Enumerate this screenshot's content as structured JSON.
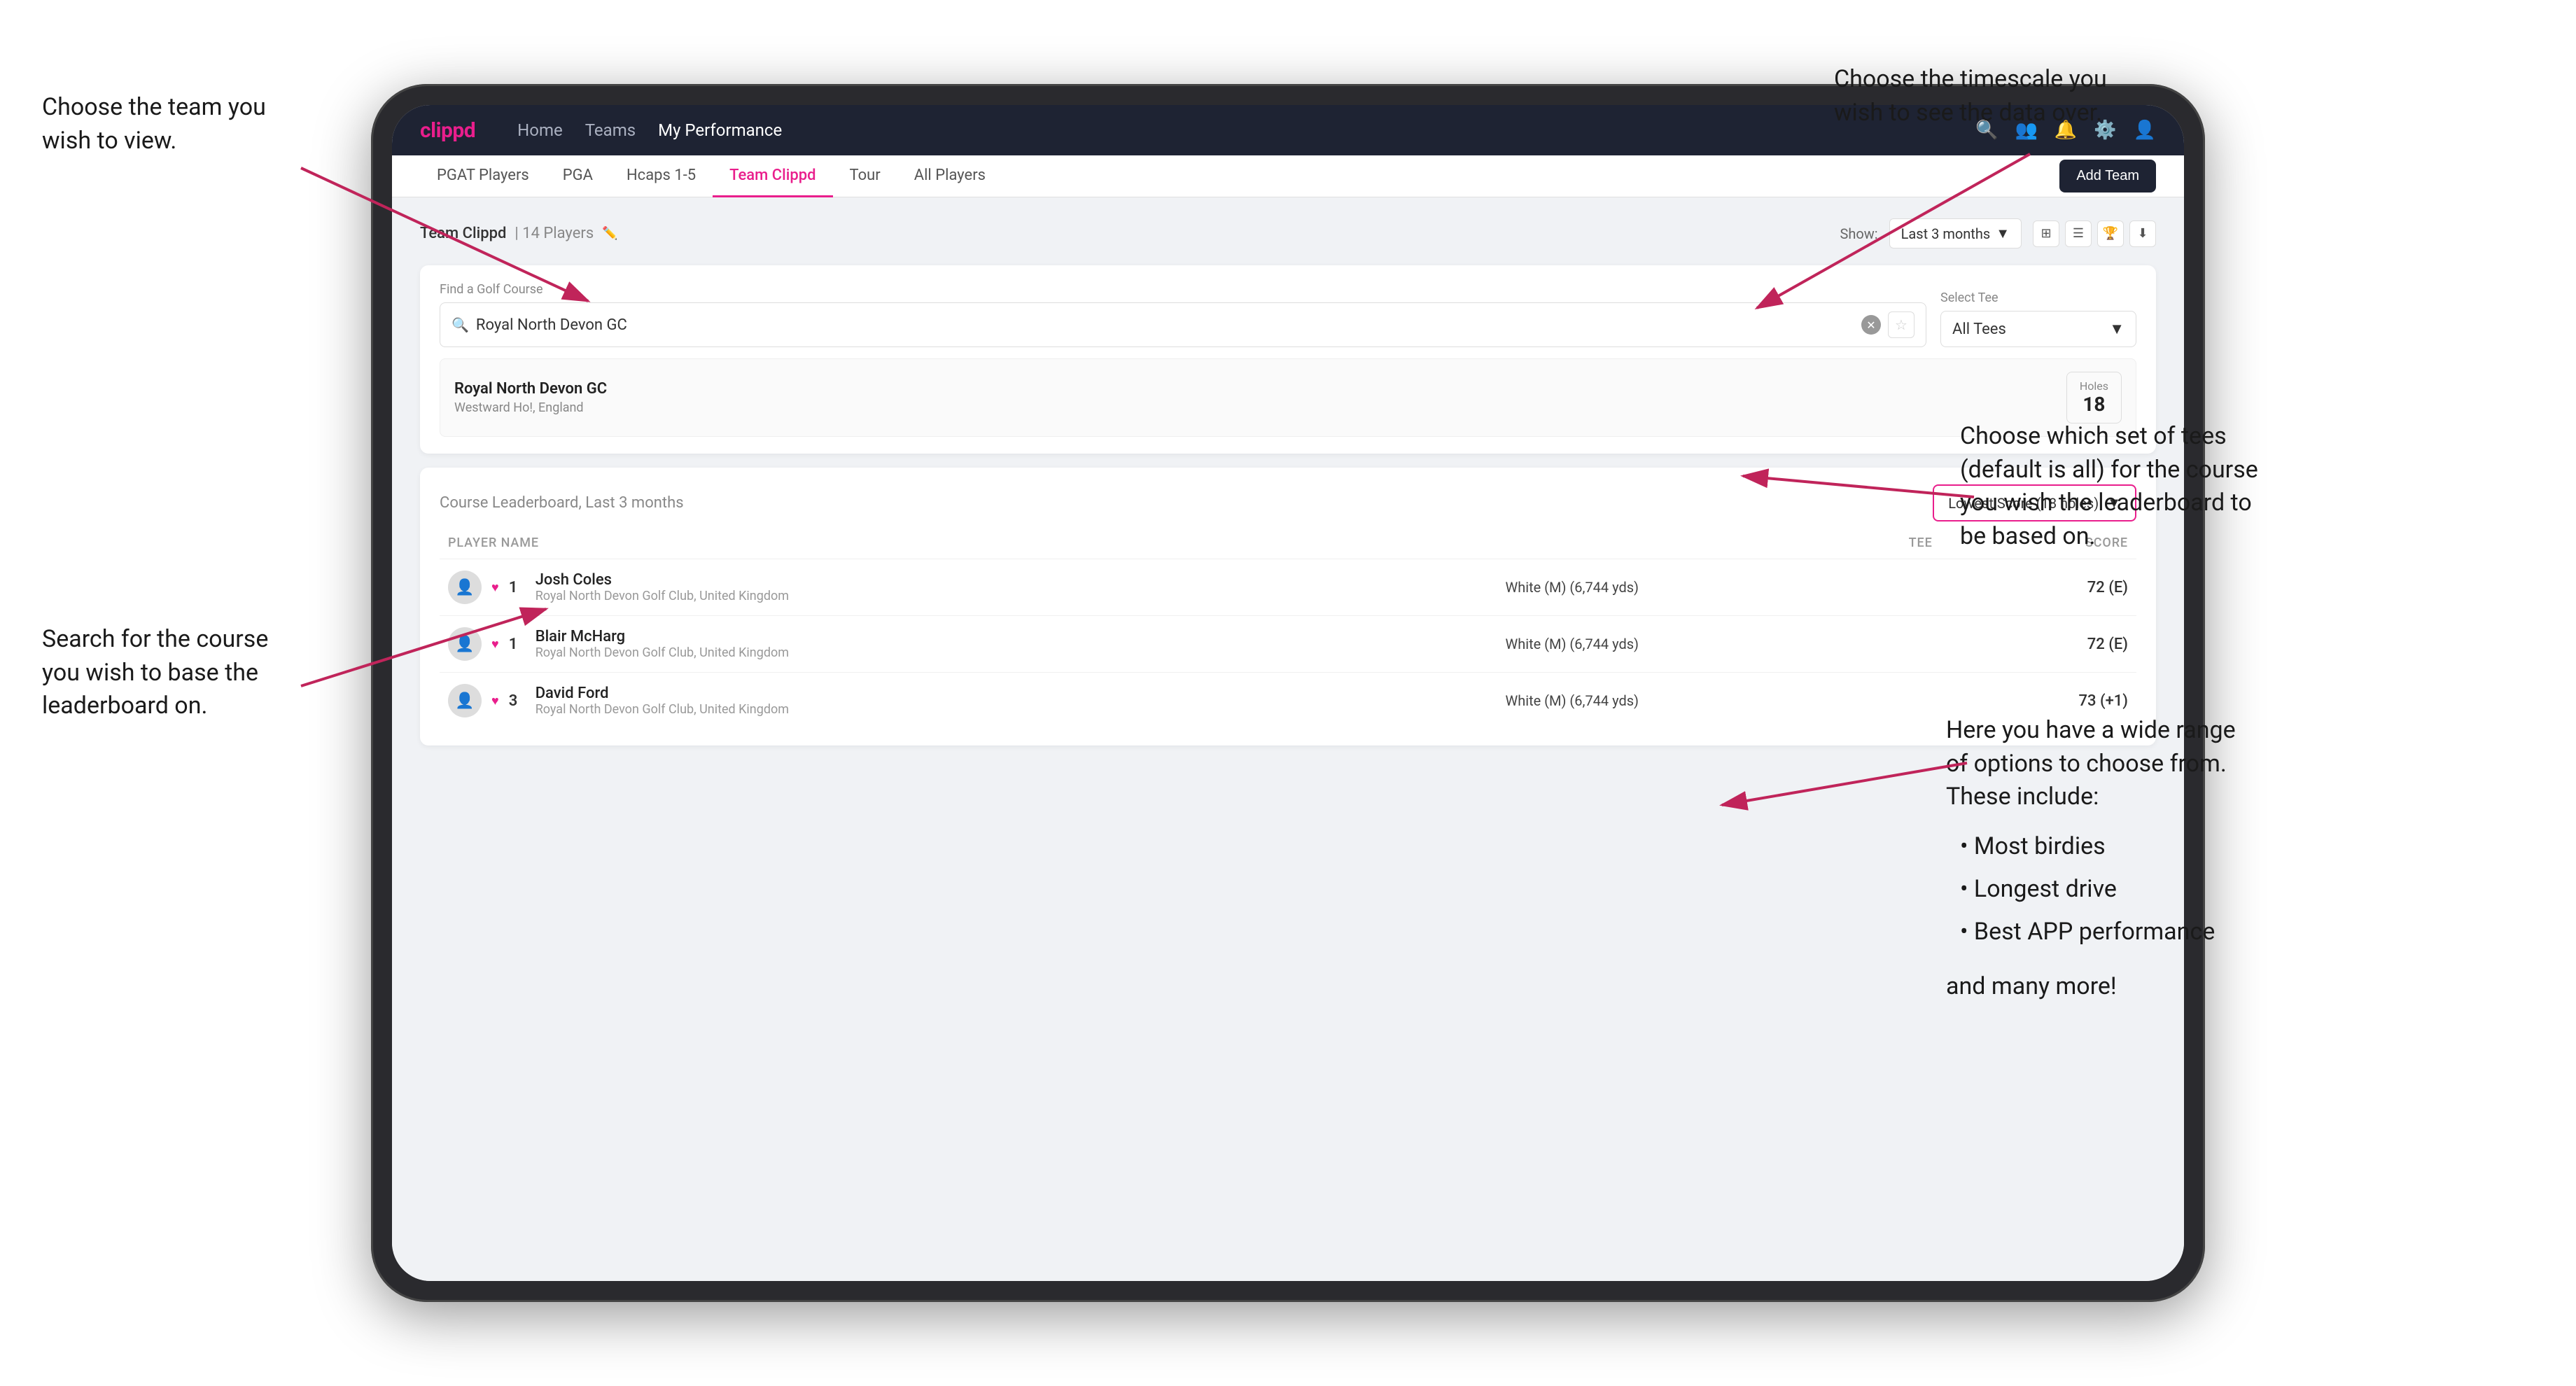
{
  "annotations": {
    "top_left_title": "Choose the team you",
    "top_left_title2": "wish to view.",
    "top_right_title": "Choose the timescale you",
    "top_right_title2": "wish to see the data over.",
    "mid_right_title": "Choose which set of tees",
    "mid_right_title2": "(default is all) for the course",
    "mid_right_title3": "you wish the leaderboard to",
    "mid_right_title4": "be based on.",
    "bot_left_title": "Search for the course",
    "bot_left_title2": "you wish to base the",
    "bot_left_title3": "leaderboard on.",
    "bot_right_title": "Here you have a wide range",
    "bot_right_title2": "of options to choose from.",
    "bot_right_title3": "These include:",
    "bot_right_bullets": [
      "Most birdies",
      "Longest drive",
      "Best APP performance"
    ],
    "bot_right_footer": "and many more!"
  },
  "navbar": {
    "logo": "clippd",
    "links": [
      "Home",
      "Teams",
      "My Performance"
    ],
    "active_link": "My Performance"
  },
  "subnav": {
    "items": [
      "PGAT Players",
      "PGA",
      "Hcaps 1-5",
      "Team Clippd",
      "Tour",
      "All Players"
    ],
    "active_item": "Team Clippd",
    "add_team_label": "Add Team"
  },
  "team_header": {
    "team_name": "Team Clippd",
    "player_count": "14 Players",
    "show_label": "Show:",
    "show_value": "Last 3 months"
  },
  "search": {
    "find_label": "Find a Golf Course",
    "placeholder": "Royal North Devon GC",
    "select_tee_label": "Select Tee",
    "tee_value": "All Tees"
  },
  "course_result": {
    "name": "Royal North Devon GC",
    "location": "Westward Ho!, England",
    "holes_label": "Holes",
    "holes_value": "18"
  },
  "leaderboard": {
    "title": "Course Leaderboard,",
    "period": "Last 3 months",
    "score_type": "Lowest Score (18 holes)",
    "columns": {
      "player": "PLAYER NAME",
      "tee": "TEE",
      "score": "SCORE"
    },
    "players": [
      {
        "rank": "1",
        "name": "Josh Coles",
        "club": "Royal North Devon Golf Club, United Kingdom",
        "tee": "White (M) (6,744 yds)",
        "score": "72 (E)"
      },
      {
        "rank": "1",
        "name": "Blair McHarg",
        "club": "Royal North Devon Golf Club, United Kingdom",
        "tee": "White (M) (6,744 yds)",
        "score": "72 (E)"
      },
      {
        "rank": "3",
        "name": "David Ford",
        "club": "Royal North Devon Golf Club, United Kingdom",
        "tee": "White (M) (6,744 yds)",
        "score": "73 (+1)"
      }
    ]
  }
}
